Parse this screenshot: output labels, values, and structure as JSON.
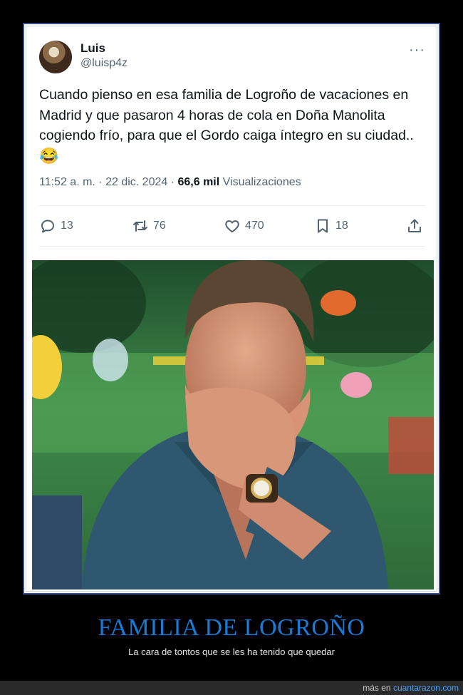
{
  "tweet": {
    "author_name": "Luis",
    "author_handle": "@luisp4z",
    "more_label": "···",
    "text": "Cuando pienso en esa familia de Logroño de vacaciones en Madrid y que pasaron 4 horas de cola en Doña Manolita cogiendo frío, para que el Gordo caiga íntegro en su ciudad..",
    "emoji": "😂",
    "time": "11:52 a. m. · 22 dic. 2024 · ",
    "views_count": "66,6 mil",
    "views_label": " Visualizaciones",
    "replies": "13",
    "retweets": "76",
    "likes": "470",
    "bookmarks": "18"
  },
  "caption": {
    "title": "FAMILIA DE LOGROÑO",
    "subtitle": "La cara de tontos que se les ha tenido que quedar"
  },
  "footer": {
    "prefix": "más en ",
    "site": "cuantarazon.com"
  },
  "colors": {
    "background": "#000000",
    "card": "#ffffff",
    "card_border": "#3b4e8c",
    "secondary_text": "#536471",
    "caption_title": "#1a7bd6"
  },
  "icons": [
    "reply-icon",
    "retweet-icon",
    "like-icon",
    "bookmark-icon",
    "share-icon",
    "more-icon"
  ]
}
